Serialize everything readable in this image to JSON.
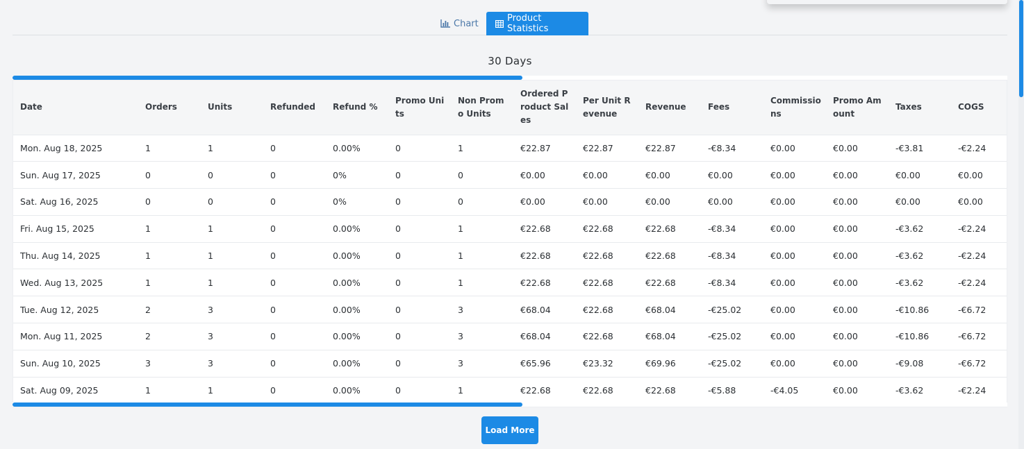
{
  "tabs": [
    {
      "label": "Chart",
      "icon": "bar-chart-icon",
      "active": false
    },
    {
      "label": "Product Statistics",
      "icon": "table-icon",
      "active": true
    }
  ],
  "range_title": "30 Days",
  "columns": [
    "Date",
    "Orders",
    "Units",
    "Refunded",
    "Refund %",
    "Promo Units",
    "Non Promo Units",
    "Ordered Product Sales",
    "Per Unit Revenue",
    "Revenue",
    "Fees",
    "Commissions",
    "Promo Amount",
    "Taxes",
    "COGS"
  ],
  "rows": [
    [
      "Mon. Aug 18, 2025",
      "1",
      "1",
      "0",
      "0.00%",
      "0",
      "1",
      "€22.87",
      "€22.87",
      "€22.87",
      "-€8.34",
      "€0.00",
      "€0.00",
      "-€3.81",
      "-€2.24"
    ],
    [
      "Sun. Aug 17, 2025",
      "0",
      "0",
      "0",
      "0%",
      "0",
      "0",
      "€0.00",
      "€0.00",
      "€0.00",
      "€0.00",
      "€0.00",
      "€0.00",
      "€0.00",
      "€0.00"
    ],
    [
      "Sat. Aug 16, 2025",
      "0",
      "0",
      "0",
      "0%",
      "0",
      "0",
      "€0.00",
      "€0.00",
      "€0.00",
      "€0.00",
      "€0.00",
      "€0.00",
      "€0.00",
      "€0.00"
    ],
    [
      "Fri. Aug 15, 2025",
      "1",
      "1",
      "0",
      "0.00%",
      "0",
      "1",
      "€22.68",
      "€22.68",
      "€22.68",
      "-€8.34",
      "€0.00",
      "€0.00",
      "-€3.62",
      "-€2.24"
    ],
    [
      "Thu. Aug 14, 2025",
      "1",
      "1",
      "0",
      "0.00%",
      "0",
      "1",
      "€22.68",
      "€22.68",
      "€22.68",
      "-€8.34",
      "€0.00",
      "€0.00",
      "-€3.62",
      "-€2.24"
    ],
    [
      "Wed. Aug 13, 2025",
      "1",
      "1",
      "0",
      "0.00%",
      "0",
      "1",
      "€22.68",
      "€22.68",
      "€22.68",
      "-€8.34",
      "€0.00",
      "€0.00",
      "-€3.62",
      "-€2.24"
    ],
    [
      "Tue. Aug 12, 2025",
      "2",
      "3",
      "0",
      "0.00%",
      "0",
      "3",
      "€68.04",
      "€22.68",
      "€68.04",
      "-€25.02",
      "€0.00",
      "€0.00",
      "-€10.86",
      "-€6.72"
    ],
    [
      "Mon. Aug 11, 2025",
      "2",
      "3",
      "0",
      "0.00%",
      "0",
      "3",
      "€68.04",
      "€22.68",
      "€68.04",
      "-€25.02",
      "€0.00",
      "€0.00",
      "-€10.86",
      "-€6.72"
    ],
    [
      "Sun. Aug 10, 2025",
      "3",
      "3",
      "0",
      "0.00%",
      "0",
      "3",
      "€65.96",
      "€23.32",
      "€69.96",
      "-€25.02",
      "€0.00",
      "€0.00",
      "-€9.08",
      "-€6.72"
    ],
    [
      "Sat. Aug 09, 2025",
      "1",
      "1",
      "0",
      "0.00%",
      "0",
      "1",
      "€22.68",
      "€22.68",
      "€22.68",
      "-€5.88",
      "-€4.05",
      "€0.00",
      "-€3.62",
      "-€2.24"
    ]
  ],
  "load_more_label": "Load More",
  "colors": {
    "accent": "#1c8ae5",
    "chart_tab_text": "#4c78a8",
    "background": "#f3f4f6"
  }
}
